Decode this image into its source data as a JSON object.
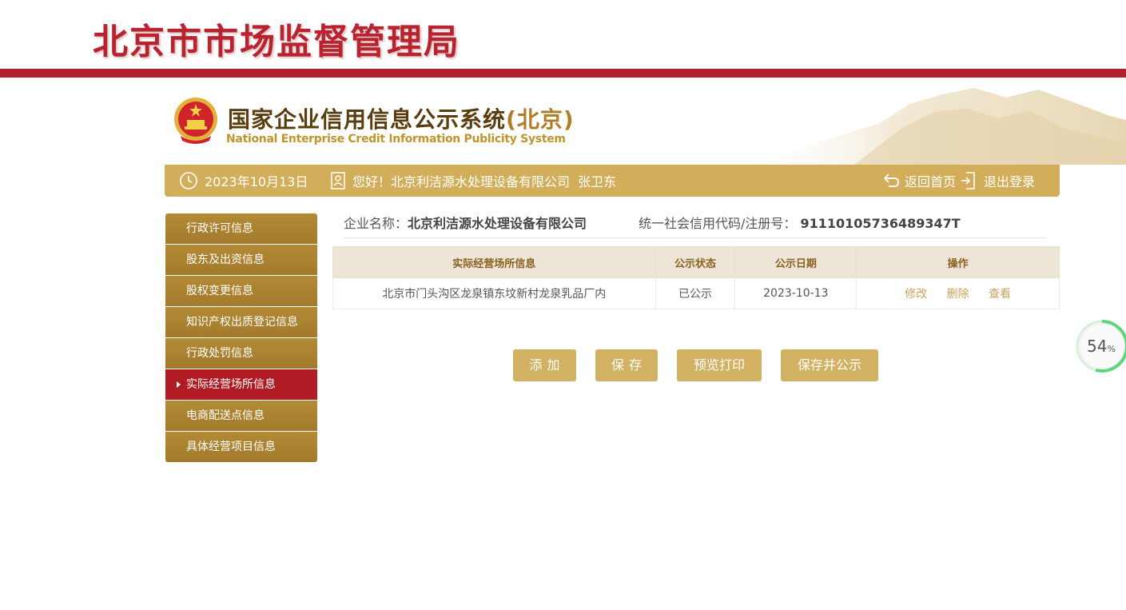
{
  "bureau": {
    "title": "北京市市场监督管理局"
  },
  "system": {
    "title_cn": "国家企业信用信息公示系统",
    "title_region": "(北京)",
    "title_en": "National Enterprise Credit Information Publicity System"
  },
  "info_bar": {
    "date": "2023年10月13日",
    "greeting": "您好！北京利洁源水处理设备有限公司  张卫东",
    "home_label": "返回首页",
    "logout_label": "退出登录"
  },
  "sidebar": {
    "items": [
      {
        "label": "行政许可信息",
        "active": false
      },
      {
        "label": "股东及出资信息",
        "active": false
      },
      {
        "label": "股权变更信息",
        "active": false
      },
      {
        "label": "知识产权出质登记信息",
        "active": false
      },
      {
        "label": "行政处罚信息",
        "active": false
      },
      {
        "label": "实际经营场所信息",
        "active": true
      },
      {
        "label": "电商配送点信息",
        "active": false
      },
      {
        "label": "具体经营项目信息",
        "active": false
      }
    ]
  },
  "company": {
    "name_label": "企业名称：",
    "name": "北京利洁源水处理设备有限公司",
    "code_label": "统一社会信用代码/注册号：",
    "code": "91110105736489347T"
  },
  "table": {
    "headers": [
      "实际经营场所信息",
      "公示状态",
      "公示日期",
      "操作"
    ],
    "rows": [
      {
        "address": "北京市门头沟区龙泉镇东坟新村龙泉乳品厂内",
        "status": "已公示",
        "date": "2023-10-13",
        "actions": [
          "修改",
          "删除",
          "查看"
        ]
      }
    ]
  },
  "buttons": {
    "add": "添加",
    "save": "保存",
    "preview": "预览打印",
    "save_publish": "保存并公示"
  },
  "progress": {
    "value": 54,
    "value_text": "54",
    "unit": "%"
  },
  "colors": {
    "brand_red": "#b31f2e",
    "gold": "#d2ae5a",
    "sidebar_gold": "#a87f30",
    "active_red": "#b11c24"
  }
}
